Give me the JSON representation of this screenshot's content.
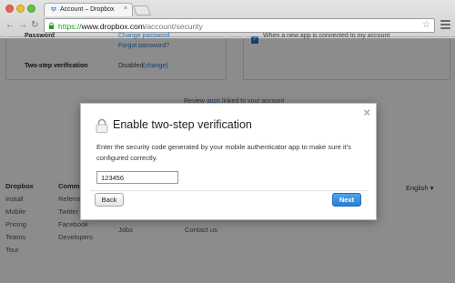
{
  "browser": {
    "tab_title": "Account – Dropbox",
    "tab_close": "×",
    "url_scheme": "https://",
    "url_host": "www.dropbox.com",
    "url_path": "/account/security",
    "star_icon": "star-icon",
    "accent_lock": "#1f9e1f"
  },
  "settings": {
    "password_label": "Password",
    "change_password": "Change password",
    "forgot_password": "Forgot password?",
    "two_step_label": "Two-step verification",
    "two_step_status": "Disabled",
    "two_step_change": "(change)",
    "notify_text": "When a new app is connected to my account",
    "review_prefix": "Review",
    "review_link": "apps",
    "review_suffix": "linked to your account"
  },
  "footer": {
    "col1": [
      "Dropbox",
      "Install",
      "Mobile",
      "Pricing",
      "Teams",
      "Tour"
    ],
    "col2": [
      "Community",
      "Referrals",
      "Twitter",
      "Facebook",
      "Developers"
    ],
    "col3_visible": [
      "Jobs"
    ],
    "col4_visible": [
      "Contact us"
    ],
    "language": "English",
    "language_arrow": "▾"
  },
  "modal": {
    "title": "Enable two-step verification",
    "body": "Enter the security code generated by your mobile authenticator app to make sure it's configured correctly.",
    "code_value": "123456",
    "back_label": "Back",
    "next_label": "Next",
    "close_glyph": "×",
    "next_color": "#2b7fd1"
  }
}
